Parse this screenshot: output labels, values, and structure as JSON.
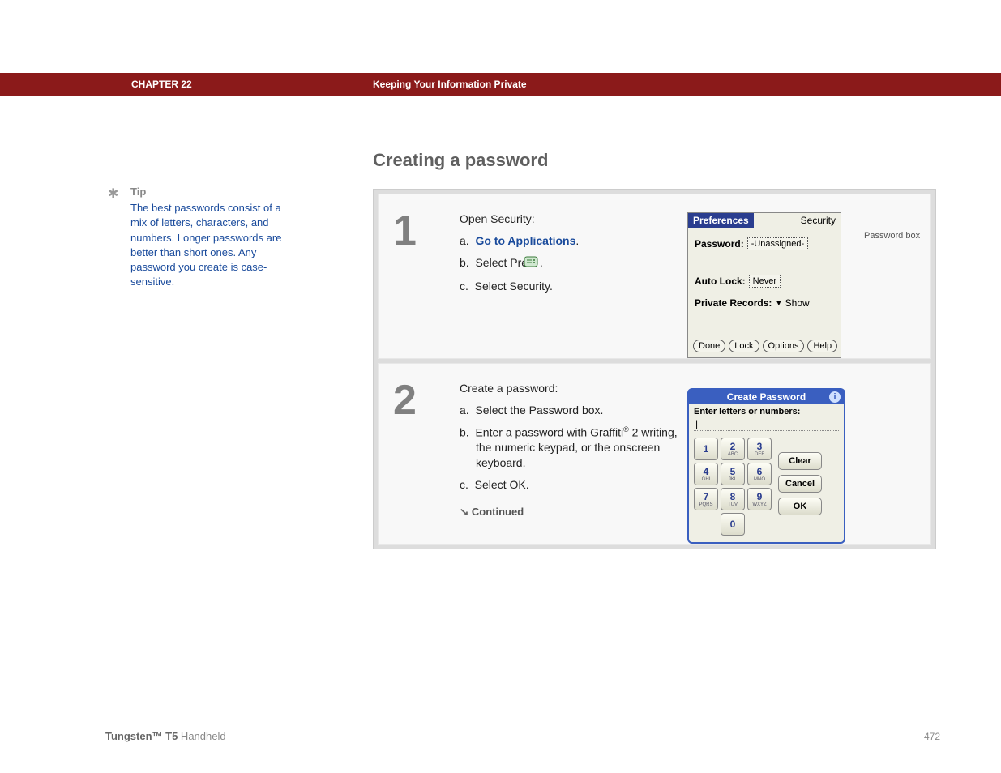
{
  "header": {
    "chapter": "CHAPTER 22",
    "title": "Keeping Your Information Private"
  },
  "section_title": "Creating a password",
  "tip": {
    "label": "Tip",
    "body": "The best passwords consist of a mix of letters, characters, and numbers. Longer passwords are better than short ones. Any password you create is case-sensitive."
  },
  "steps": [
    {
      "number": "1",
      "intro": "Open Security:",
      "items": {
        "a_prefix": "a.",
        "a_link": "Go to Applications",
        "a_suffix": ".",
        "b_prefix": "b.",
        "b_text_before": "Select Prefs ",
        "b_text_after": ".",
        "c_prefix": "c.",
        "c_text": "Select Security."
      },
      "prefs": {
        "title": "Preferences",
        "security": "Security",
        "password_label": "Password:",
        "password_value": "-Unassigned-",
        "autolock_label": "Auto Lock:",
        "autolock_value": "Never",
        "private_label": "Private Records:",
        "private_value": "Show",
        "buttons": {
          "done": "Done",
          "lock": "Lock",
          "options": "Options",
          "help": "Help"
        },
        "callout": "Password box"
      }
    },
    {
      "number": "2",
      "intro": "Create a password:",
      "items": {
        "a_prefix": "a.",
        "a_text": "Select the Password box.",
        "b_prefix": "b.",
        "b_before": "Enter a password with Graffiti",
        "b_after": " 2 writing, the numeric keypad, or the onscreen keyboard.",
        "c_prefix": "c.",
        "c_text": "Select OK."
      },
      "dialog": {
        "title": "Create Password",
        "subtitle": "Enter letters or numbers:",
        "cursor": "|",
        "keys": [
          {
            "n": "1",
            "s": ""
          },
          {
            "n": "2",
            "s": "ABC"
          },
          {
            "n": "3",
            "s": "DEF"
          },
          {
            "n": "4",
            "s": "GHI"
          },
          {
            "n": "5",
            "s": "JKL"
          },
          {
            "n": "6",
            "s": "MNO"
          },
          {
            "n": "7",
            "s": "PQRS"
          },
          {
            "n": "8",
            "s": "TUV"
          },
          {
            "n": "9",
            "s": "WXYZ"
          },
          {
            "n": "0",
            "s": ""
          }
        ],
        "clear": "Clear",
        "cancel": "Cancel",
        "ok": "OK"
      },
      "continued": "Continued"
    }
  ],
  "footer": {
    "product_bold": "Tungsten™ T5",
    "product_rest": " Handheld",
    "page": "472"
  }
}
